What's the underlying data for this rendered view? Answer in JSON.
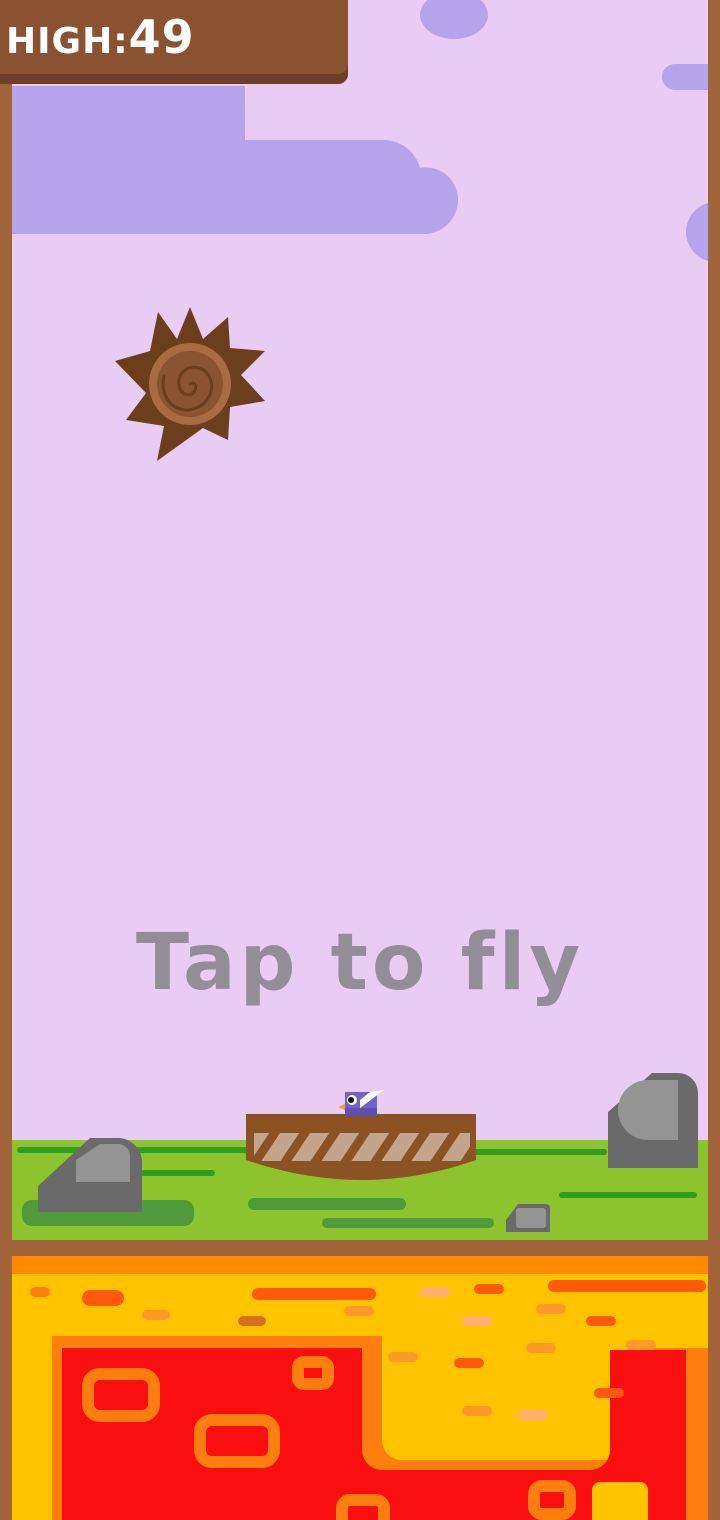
{
  "score": {
    "label": "HIGH:",
    "value": "49"
  },
  "hint": {
    "text": "Tap to fly"
  },
  "icons": {
    "hazard": "spiked-wheel-icon",
    "player": "bird-icon",
    "platform": "nest-basket-icon",
    "terrain": "rock-icon",
    "floor": "lava"
  },
  "colors": {
    "sky": "#e8ccf3",
    "clouds": "#b7a3eb",
    "wall": "#a2643a",
    "score_panel": "#8b5232",
    "grass": "#8dc42d",
    "lava_red": "#fa0f10",
    "lava_yellow": "#ffc300",
    "lava_orange": "#ff7f0e",
    "hint_text": "#938d98"
  }
}
